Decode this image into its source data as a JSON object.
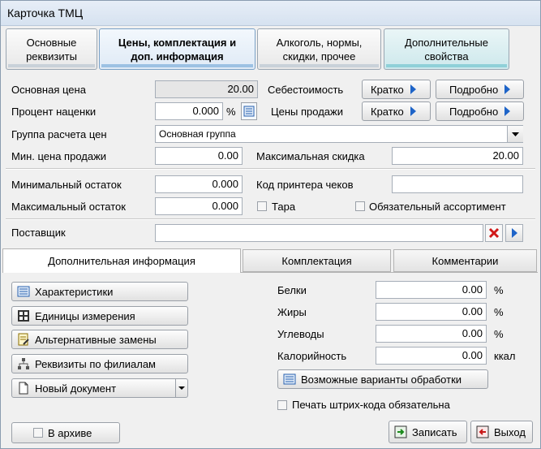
{
  "window": {
    "title": "Карточка ТМЦ"
  },
  "tabs": [
    {
      "line1": "Основные",
      "line2": "реквизиты"
    },
    {
      "line1": "Цены, комплектация и",
      "line2": "доп. информация"
    },
    {
      "line1": "Алкоголь, нормы,",
      "line2": "скидки, прочее"
    },
    {
      "line1": "Дополнительные",
      "line2": "свойства"
    }
  ],
  "prices": {
    "base_price_label": "Основная цена",
    "base_price_value": "20.00",
    "markup_label": "Процент наценки",
    "markup_value": "0.000",
    "markup_unit": "%",
    "group_label": "Группа расчета цен",
    "group_value": "Основная группа",
    "min_price_label": "Мин. цена продажи",
    "min_price_value": "0.00",
    "cost_label": "Себестоимость",
    "sale_prices_label": "Цены продажи",
    "brief_label": "Кратко",
    "detail_label": "Подробно",
    "max_discount_label": "Максимальная скидка",
    "max_discount_value": "20.00"
  },
  "stock": {
    "min_label": "Минимальный остаток",
    "min_value": "0.000",
    "max_label": "Максимальный остаток",
    "max_value": "0.000",
    "printer_code_label": "Код принтера чеков",
    "printer_code_value": "",
    "tare_label": "Тара",
    "mandatory_label": "Обязательный ассортимент"
  },
  "supplier": {
    "label": "Поставщик",
    "value": ""
  },
  "lower_tabs": [
    "Дополнительная информация",
    "Комплектация",
    "Комментарии"
  ],
  "actions": [
    "Характеристики",
    "Единицы измерения",
    "Альтернативные замены",
    "Реквизиты по филиалам",
    "Новый документ"
  ],
  "nutrition": [
    {
      "label": "Белки",
      "value": "0.00",
      "unit": "%"
    },
    {
      "label": "Жиры",
      "value": "0.00",
      "unit": "%"
    },
    {
      "label": "Углеводы",
      "value": "0.00",
      "unit": "%"
    },
    {
      "label": "Калорийность",
      "value": "0.00",
      "unit": "ккал"
    }
  ],
  "processing_button": "Возможные варианты обработки",
  "barcode_label": "Печать штрих-кода обязательна",
  "archive_label": "В архиве",
  "save_label": "Записать",
  "exit_label": "Выход"
}
